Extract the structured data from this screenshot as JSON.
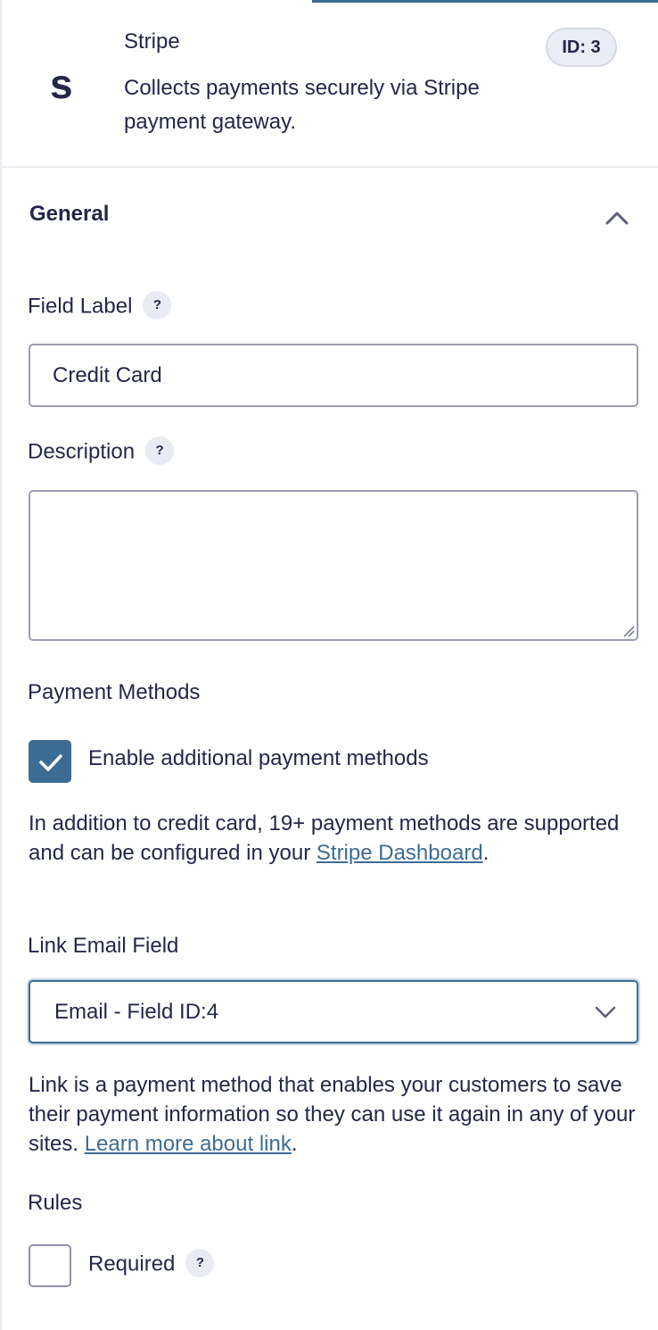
{
  "field": {
    "icon_letter": "s",
    "name": "Stripe",
    "description": "Collects payments securely via Stripe payment gateway.",
    "id_badge": "ID: 3"
  },
  "section": {
    "title": "General",
    "collapse_icon": "chevron-up-icon"
  },
  "field_label": {
    "label": "Field Label",
    "help": "?",
    "value": "Credit Card"
  },
  "description": {
    "label": "Description",
    "help": "?",
    "value": ""
  },
  "payment_methods": {
    "label": "Payment Methods",
    "checkbox_label": "Enable additional payment methods",
    "checked": true,
    "info_text": "In addition to credit card, 19+ payment methods are supported and can be configured in your ",
    "link_text": "Stripe Dashboard",
    "info_suffix": "."
  },
  "link_email": {
    "label": "Link Email Field",
    "selected": "Email - Field ID:4",
    "info_text": "Link is a payment method that enables your customers to save their payment information so they can use it again in any of your sites. ",
    "link_text": "Learn more about link",
    "info_suffix": "."
  },
  "rules": {
    "label": "Rules",
    "required_label": "Required",
    "help": "?",
    "required_checked": false
  },
  "colors": {
    "accent": "#3d6c93",
    "text": "#242748",
    "border": "#9c9eb2"
  }
}
